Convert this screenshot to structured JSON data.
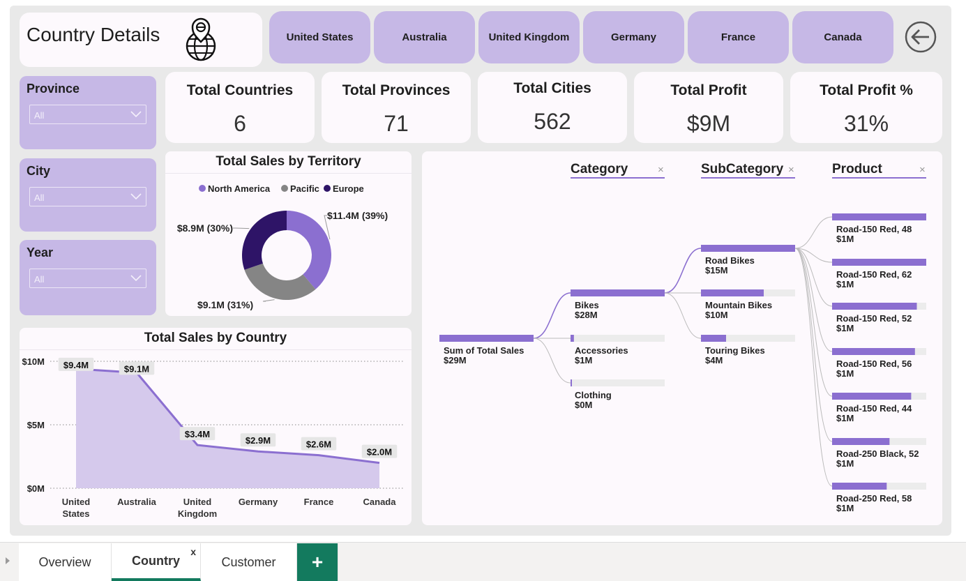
{
  "header": {
    "title": "Country Details",
    "icon": "globe-location-icon"
  },
  "country_buttons": [
    "United States",
    "Australia",
    "United Kingdom",
    "Germany",
    "France",
    "Canada"
  ],
  "back_button": {
    "icon": "back-arrow-icon"
  },
  "slicers": [
    {
      "title": "Province",
      "value": "All"
    },
    {
      "title": "City",
      "value": "All"
    },
    {
      "title": "Year",
      "value": "All"
    }
  ],
  "kpis": [
    {
      "label": "Total Countries",
      "value": "6"
    },
    {
      "label": "Total Provinces",
      "value": "71"
    },
    {
      "label": "Total Cities",
      "value": "562"
    },
    {
      "label": "Total Profit",
      "value": "$9M"
    },
    {
      "label": "Total Profit %",
      "value": "31%"
    }
  ],
  "territory_chart": {
    "title": "Total Sales by Territory",
    "legend": [
      "North America",
      "Pacific",
      "Europe"
    ],
    "labels": [
      "$11.4M (39%)",
      "$9.1M (31%)",
      "$8.9M (30%)"
    ]
  },
  "country_chart": {
    "title": "Total Sales by Country",
    "y_ticks": [
      "$10M",
      "$5M",
      "$0M"
    ],
    "x_labels": [
      [
        "United",
        "States"
      ],
      [
        "Australia"
      ],
      [
        "United",
        "Kingdom"
      ],
      [
        "Germany"
      ],
      [
        "France"
      ],
      [
        "Canada"
      ]
    ],
    "data_labels": [
      "$9.4M",
      "$9.1M",
      "$3.4M",
      "$2.9M",
      "$2.6M",
      "$2.0M"
    ]
  },
  "tree": {
    "levels": [
      "Category",
      "SubCategory",
      "Product"
    ],
    "root": {
      "label": "Sum of Total Sales",
      "value": "$29M"
    },
    "categories": [
      {
        "label": "Bikes",
        "value": "$28M"
      },
      {
        "label": "Accessories",
        "value": "$1M"
      },
      {
        "label": "Clothing",
        "value": "$0M"
      }
    ],
    "subcategories": [
      {
        "label": "Road Bikes",
        "value": "$15M"
      },
      {
        "label": "Mountain Bikes",
        "value": "$10M"
      },
      {
        "label": "Touring Bikes",
        "value": "$4M"
      }
    ],
    "products": [
      {
        "label": "Road-150 Red, 48",
        "value": "$1M"
      },
      {
        "label": "Road-150 Red, 62",
        "value": "$1M"
      },
      {
        "label": "Road-150 Red, 52",
        "value": "$1M"
      },
      {
        "label": "Road-150 Red, 56",
        "value": "$1M"
      },
      {
        "label": "Road-150 Red, 44",
        "value": "$1M"
      },
      {
        "label": "Road-250 Black, 52",
        "value": "$1M"
      },
      {
        "label": "Road-250 Red, 58",
        "value": "$1M"
      }
    ]
  },
  "tabs": {
    "overview": "Overview",
    "country": "Country",
    "customer": "Customer",
    "close": "x",
    "add": "+"
  },
  "colors": {
    "accent": "#8b6fd0",
    "button": "#c6b8e6",
    "europe": "#2e1467",
    "pacific": "#858585",
    "add_tab": "#137a5e"
  },
  "chart_data": [
    {
      "type": "pie",
      "title": "Total Sales by Territory",
      "categories": [
        "North America",
        "Pacific",
        "Europe"
      ],
      "values": [
        11.4,
        9.1,
        8.9
      ],
      "percent": [
        39,
        31,
        30
      ],
      "unit": "$M",
      "legend": "top"
    },
    {
      "type": "area",
      "title": "Total Sales by Country",
      "categories": [
        "United States",
        "Australia",
        "United Kingdom",
        "Germany",
        "France",
        "Canada"
      ],
      "values": [
        9.4,
        9.1,
        3.4,
        2.9,
        2.6,
        2.0
      ],
      "unit": "$M",
      "ylim": [
        0,
        10
      ],
      "grid": true
    },
    {
      "type": "bar",
      "title": "Decomposition tree: Sum of Total Sales",
      "series": [
        {
          "name": "Category",
          "categories": [
            "Bikes",
            "Accessories",
            "Clothing"
          ],
          "values": [
            28,
            1,
            0
          ]
        },
        {
          "name": "SubCategory",
          "categories": [
            "Road Bikes",
            "Mountain Bikes",
            "Touring Bikes"
          ],
          "values": [
            15,
            10,
            4
          ]
        },
        {
          "name": "Product",
          "categories": [
            "Road-150 Red, 48",
            "Road-150 Red, 62",
            "Road-150 Red, 52",
            "Road-150 Red, 56",
            "Road-150 Red, 44",
            "Road-250 Black, 52",
            "Road-250 Red, 58"
          ],
          "values": [
            1,
            1,
            1,
            1,
            1,
            1,
            1
          ]
        }
      ],
      "unit": "$M"
    }
  ]
}
